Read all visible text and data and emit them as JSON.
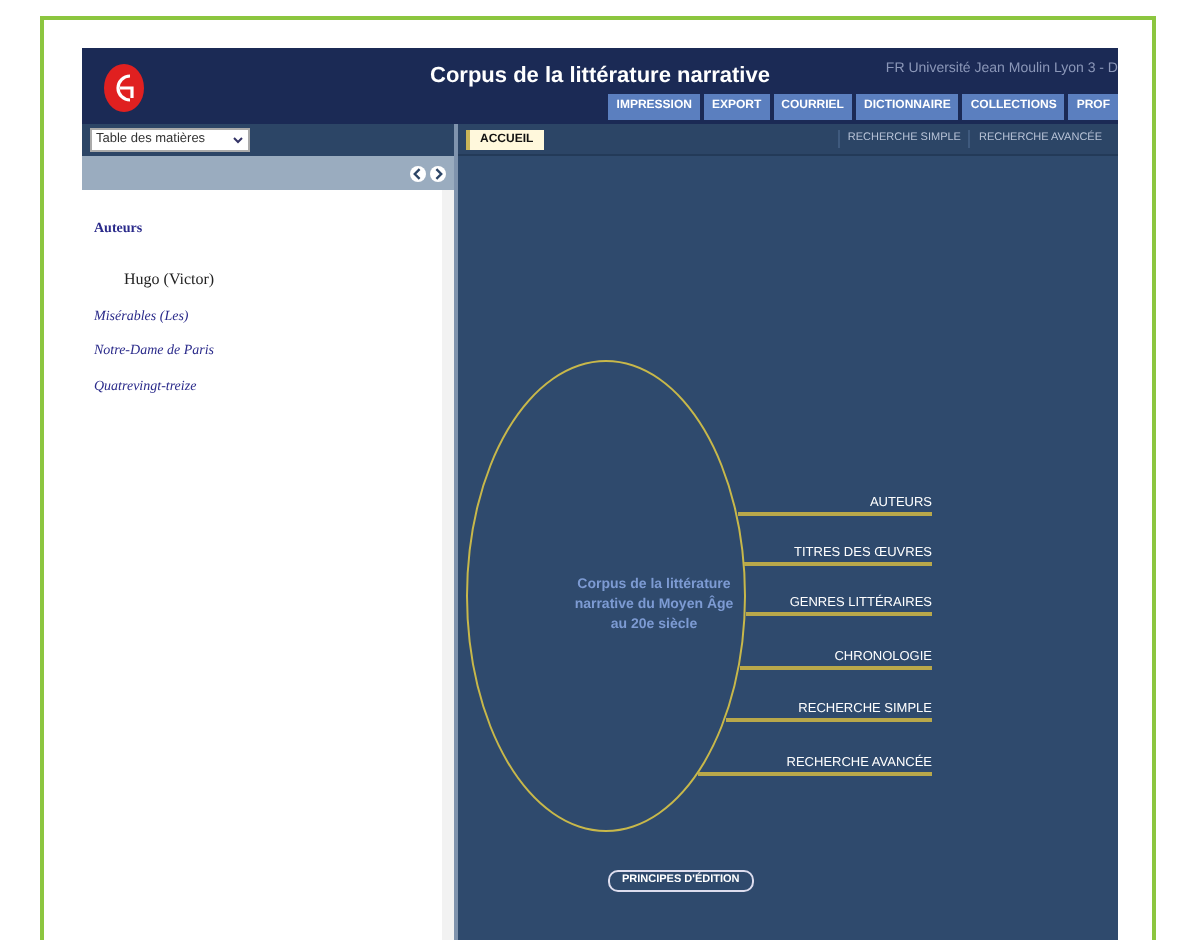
{
  "header": {
    "title": "Corpus de la littérature narrative",
    "institution": "FR Université Jean Moulin Lyon 3 - D"
  },
  "toolbar": [
    "IMPRESSION",
    "EXPORT",
    "COURRIEL",
    "DICTIONNAIRE",
    "COLLECTIONS",
    "PROF"
  ],
  "sidebar": {
    "select": {
      "value": "Table des matières"
    },
    "heading": "Auteurs",
    "items": [
      {
        "label": "Hugo (Victor)",
        "kind": "author"
      },
      {
        "label": "Misérables (Les)",
        "kind": "work"
      },
      {
        "label": "Notre-Dame de Paris",
        "kind": "work"
      },
      {
        "label": "Quatrevingt-treize",
        "kind": "work"
      }
    ]
  },
  "main": {
    "tabs": [
      {
        "label": "ACCUEIL",
        "selected": true
      }
    ],
    "links": [
      "RECHERCHE SIMPLE",
      "RECHERCHE AVANCÉE"
    ],
    "center_text": "Corpus de la littérature narrative du Moyen Âge au 20e siècle",
    "menu": [
      "AUTEURS",
      "TITRES DES ŒUVRES",
      "GENRES LITTÉRAIRES",
      "CHRONOLOGIE",
      "RECHERCHE SIMPLE",
      "RECHERCHE AVANCÉE"
    ],
    "button": "PRINCIPES D'ÉDITION"
  }
}
